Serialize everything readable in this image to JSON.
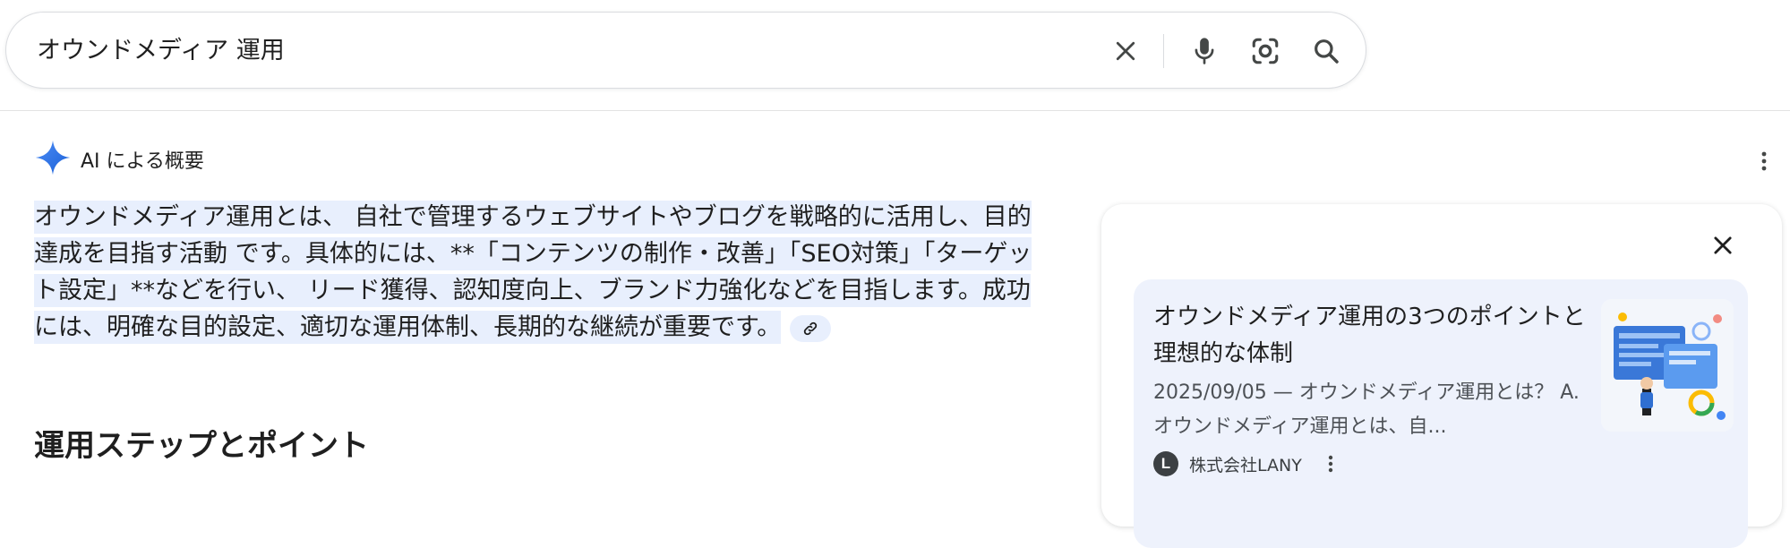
{
  "search": {
    "query": "オウンドメディア 運用",
    "clear_icon": "close-icon",
    "voice_icon": "mic-icon",
    "lens_icon": "lens-icon",
    "search_icon": "search-icon"
  },
  "ai_overview": {
    "label": "AI による概要",
    "icon": "sparkle-icon",
    "summary": "オウンドメディア運用とは、 自社で管理するウェブサイトやブログを戦略的に活用し、目的達成を目指す活動 です。具体的には、**「コンテンツの制作・改善」「SEO対策」「ターゲット設定」**などを行い、 リード獲得、認知度向上、ブランド力強化などを目指します。成功には、明確な目的設定、適切な運用体制、長期的な継続が重要です。",
    "link_icon": "link-icon",
    "section_heading": "運用ステップとポイント"
  },
  "source_card": {
    "title": "オウンドメディア運用の3つのポイントと理想的な体制",
    "snippet": "2025/09/05 — オウンドメディア運用とは？ A. オウンドメディア運用とは、自...",
    "source_logo": "L",
    "source_name": "株式会社LANY"
  },
  "colors": {
    "highlight": "#e8effd",
    "card_bg": "#eef2fc",
    "sparkle": "#4285f4",
    "text": "#1f1f1f",
    "secondary_text": "#4d5156"
  }
}
